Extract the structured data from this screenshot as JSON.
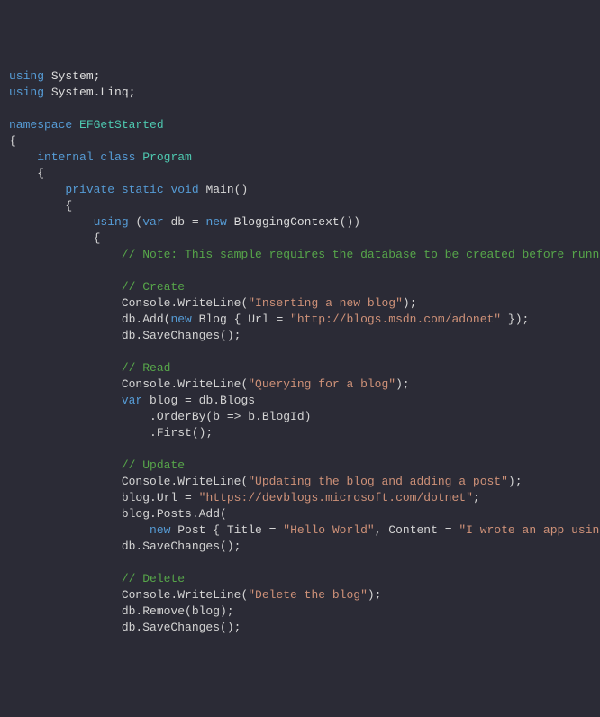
{
  "code": {
    "l1_using": "using",
    "l1_ns": " System;",
    "l2_using": "using",
    "l2_ns": " System.Linq;",
    "l4_ns": "namespace",
    "l4_name": " EFGetStarted",
    "l5_brace": "{",
    "l6_internal": "    internal",
    "l6_class": " class",
    "l6_name": " Program",
    "l7_brace": "    {",
    "l8_private": "        private",
    "l8_static": " static",
    "l8_void": " void",
    "l8_main": " Main",
    "l8_paren": "()",
    "l9_brace": "        {",
    "l10_using": "            using",
    "l10_paren1": " (",
    "l10_var": "var",
    "l10_db": " db = ",
    "l10_new": "new",
    "l10_ctx": " BloggingContext",
    "l10_paren2": "())",
    "l11_brace": "            {",
    "l12_cmt": "                // Note: This sample requires the database to be created before runni",
    "l14_cmt": "                // Create",
    "l15_pre": "                Console.WriteLine(",
    "l15_str": "\"Inserting a new blog\"",
    "l15_post": ");",
    "l16_pre": "                db.Add(",
    "l16_new": "new",
    "l16_blog": " Blog { Url = ",
    "l16_str": "\"http://blogs.msdn.com/adonet\"",
    "l16_post": " });",
    "l17": "                db.SaveChanges();",
    "l19_cmt": "                // Read",
    "l20_pre": "                Console.WriteLine(",
    "l20_str": "\"Querying for a blog\"",
    "l20_post": ");",
    "l21_pre": "                ",
    "l21_var": "var",
    "l21_post": " blog = db.Blogs",
    "l22": "                    .OrderBy(b => b.BlogId)",
    "l23": "                    .First();",
    "l25_cmt": "                // Update",
    "l26_pre": "                Console.WriteLine(",
    "l26_str": "\"Updating the blog and adding a post\"",
    "l26_post": ");",
    "l27_pre": "                blog.Url = ",
    "l27_str": "\"https://devblogs.microsoft.com/dotnet\"",
    "l27_post": ";",
    "l28": "                blog.Posts.Add(",
    "l29_pre": "                    ",
    "l29_new": "new",
    "l29_post1": " Post { Title = ",
    "l29_str1": "\"Hello World\"",
    "l29_post2": ", Content = ",
    "l29_str2": "\"I wrote an app using",
    "l30": "                db.SaveChanges();",
    "l32_cmt": "                // Delete",
    "l33_pre": "                Console.WriteLine(",
    "l33_str": "\"Delete the blog\"",
    "l33_post": ");",
    "l34": "                db.Remove(blog);",
    "l35": "                db.SaveChanges();"
  }
}
